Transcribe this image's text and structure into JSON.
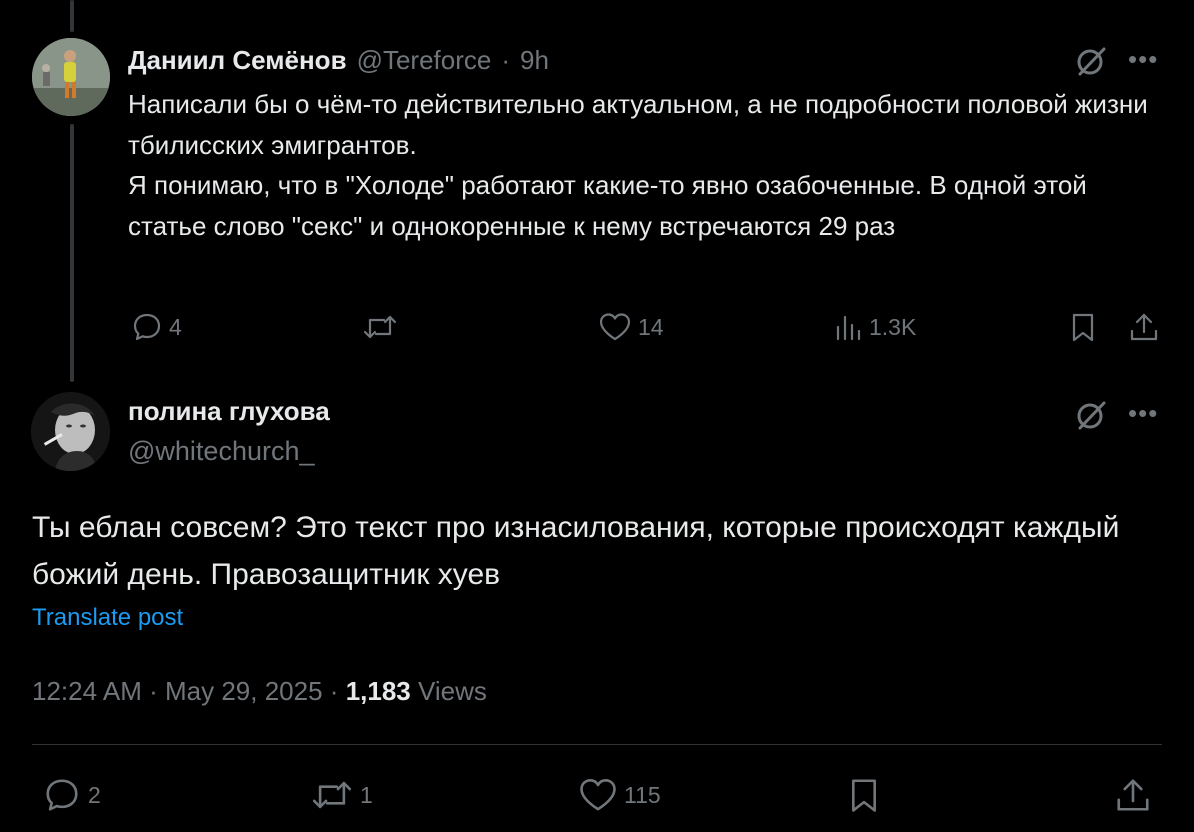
{
  "reply": {
    "author_name": "Даниил Семёнов",
    "handle": "@Tereforce",
    "separator": "·",
    "time": "9h",
    "text_lines": [
      "Написали бы о чём-то действительно актуальном, а не подробности половой жизни тбилисских эмигрантов.",
      "Я понимаю, что в \"Холоде\" работают какие-то явно озабоченные. В одной этой статье слово \"секс\" и однокоренные к нему встречаются 29 раз"
    ],
    "counts": {
      "replies": "4",
      "likes": "14",
      "views": "1.3K"
    }
  },
  "main": {
    "author_name": "полина глухова",
    "handle": "@whitechurch_",
    "text": "Ты еблан совсем? Это текст про изнасилования, которые происходят каждый божий день. Правозащитник хуев",
    "translate_label": "Translate post",
    "time": "12:24 AM",
    "separator": "·",
    "date": "May 29, 2025",
    "views_count": "1,183",
    "views_label": "Views",
    "counts": {
      "replies": "2",
      "reposts": "1",
      "likes": "115"
    }
  },
  "icons": {
    "reply": "reply-icon",
    "repost": "repost-icon",
    "like": "heart-icon",
    "views": "analytics-icon",
    "bookmark": "bookmark-icon",
    "share": "share-icon",
    "grok": "grok-icon",
    "more": "more-icon"
  },
  "colors": {
    "background": "#000000",
    "text": "#e7e9ea",
    "muted": "#71767b",
    "link": "#1d9bf0",
    "divider": "#2f3336"
  }
}
